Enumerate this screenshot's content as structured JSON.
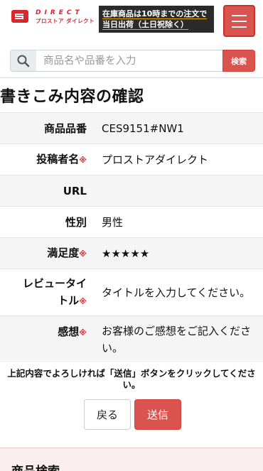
{
  "header": {
    "logo_top": "DIRECT",
    "logo_bottom": "プロストア ダイレクト",
    "banner_line1": "在庫商品は10時までの注文で",
    "banner_line2": "当日出荷（土日祝除く）",
    "menu_icon": "hamburger-icon",
    "accent_color": "#d9534f"
  },
  "search": {
    "icon": "search-icon",
    "placeholder": "商品名や品番を入力",
    "button_label": "検索"
  },
  "page_title": "書きこみ内容の確認",
  "required_mark": "※",
  "rows": [
    {
      "label": "商品品番",
      "value": "CES9151#NW1",
      "required": false
    },
    {
      "label": "投稿者名",
      "value": "プロストアダイレクト",
      "required": true
    },
    {
      "label": "URL",
      "value": "",
      "required": false
    },
    {
      "label": "性別",
      "value": "男性",
      "required": false
    },
    {
      "label": "満足度",
      "value": "★★★★★",
      "required": true
    },
    {
      "label_line1": "レビュータイ",
      "label_line2": "トル",
      "value": "タイトルを入力してください。",
      "required": true
    },
    {
      "label": "感想",
      "value": "お客様のご感想をご記入ください。",
      "required": true
    }
  ],
  "notice": "上記内容でよろしければ「送信」ボタンをクリックしてください。",
  "buttons": {
    "back": "戻る",
    "send": "送信"
  },
  "footer": {
    "title": "商品検索"
  }
}
